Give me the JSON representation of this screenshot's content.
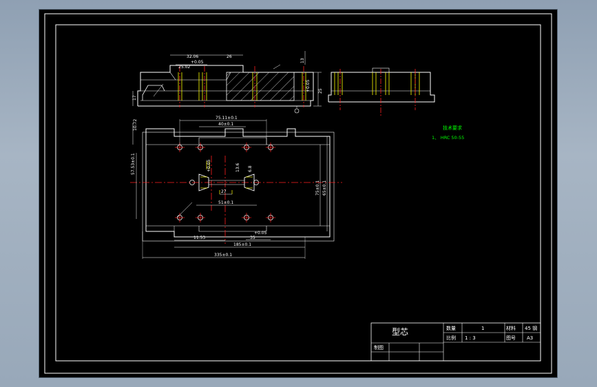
{
  "colors": {
    "background": "#000000",
    "outline": "#ffffff",
    "hidden": "#ffff00",
    "center": "#ff2020",
    "hatch": "#ffffff",
    "notes": "#00ff00",
    "viewport": "#98a8b9"
  },
  "title_block": {
    "part_name": "型芯",
    "qty_label": "数量",
    "qty_value": "1",
    "material_label": "材料",
    "material_value": "45 钢",
    "scale_label": "比例",
    "scale_value": "1 : 3",
    "drawing_no_label": "图号",
    "drawing_no_value": "A3",
    "drafter_label": "制图"
  },
  "tech_notes": {
    "title": "技术要求",
    "line1": "1、 HRC 50-55"
  },
  "dimensions": {
    "d_32": "32.06",
    "d_25_02": "25.02",
    "d_tol_top": "+0.05",
    "d_26": "26",
    "d_13": "13",
    "d_17_2": "17",
    "d_vert_005": "+0.05",
    "d_25": "25",
    "d_75": "75.11±0.1",
    "d_40": "40±0.1",
    "d_1072": "10.72",
    "d_57": "57.53±0.1",
    "d_005_b": "+0.05",
    "d_13_6": "13.6",
    "d_6_8": "6.8",
    "d_75_r": "75±0.1",
    "d_65": "65±0.1",
    "d_27": "27",
    "d_51": "51±0.1",
    "d_11_53": "11.53",
    "d_005_c": "+0.05",
    "d_35": "35",
    "d_185": "185±0.1",
    "d_335": "335±0.1"
  }
}
